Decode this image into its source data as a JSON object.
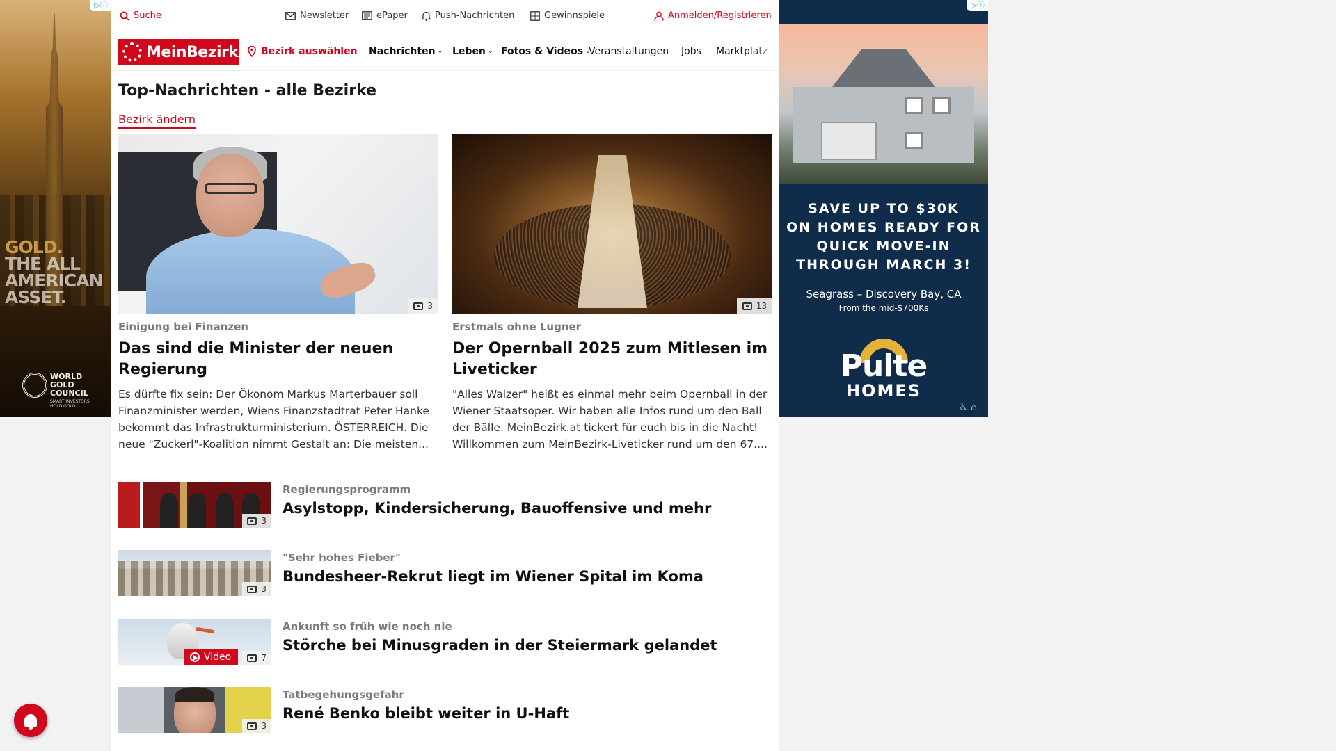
{
  "colors": {
    "brand_red": "#d1081c",
    "kicker_gray": "#7a7a7a"
  },
  "ad_left": {
    "slogan_lines": [
      "GOLD.",
      "THE ALL",
      "AMERICAN",
      "ASSET."
    ],
    "org": "WORLD GOLD COUNCIL",
    "tagline": "SMART INVESTORS HOLD GOLD"
  },
  "ad_right": {
    "headline_lines": [
      "SAVE UP TO $30K",
      "ON HOMES READY FOR",
      "QUICK MOVE-IN",
      "THROUGH MARCH 3!"
    ],
    "location": "Seagrass – Discovery Bay, CA",
    "price": "From the mid-$700Ks",
    "brand_top": "Pulte",
    "brand_bottom": "HOMES"
  },
  "topbar": {
    "search": "Suche",
    "newsletter": "Newsletter",
    "epaper": "ePaper",
    "push": "Push-Nachrichten",
    "gewinnspiele": "Gewinnspiele",
    "login": "Anmelden/Registrieren"
  },
  "nav": {
    "logo": "MeinBezirk",
    "bezirk": "Bezirk auswählen",
    "nachrichten": "Nachrichten",
    "leben": "Leben",
    "fotos": "Fotos & Videos",
    "veranstaltungen": "Veranstaltungen",
    "jobs": "Jobs",
    "marktplatz": "Marktplatz"
  },
  "page": {
    "title": "Top-Nachrichten - alle Bezirke",
    "change_bezirk": "Bezirk ändern"
  },
  "featured": [
    {
      "photo_count": "3",
      "kicker": "Einigung bei Finanzen",
      "headline": "Das sind die Minister der neuen Regierung",
      "teaser": "Es dürfte fix sein: Der Ökonom Markus Marterbauer soll Finanzminister werden, Wiens Finanzstadtrat Peter Hanke bekommt das Infrastrukturministerium. ÖSTERREICH. Die neue \"Zuckerl\"-Koalition nimmt Gestalt an: Die meisten..."
    },
    {
      "photo_count": "13",
      "kicker": "Erstmals ohne Lugner",
      "headline": "Der Opernball 2025 zum Mitlesen im Liveticker",
      "teaser": "\"Alles Walzer\" heißt es einmal mehr beim Opernball in der Wiener Staatsoper. Wir haben alle Infos rund um den Ball der Bälle. MeinBezirk.at tickert für euch bis in die Nacht! Willkommen zum MeinBezirk-Liveticker rund um den 67...."
    }
  ],
  "list": [
    {
      "kicker": "Regierungsprogramm",
      "headline": "Asylstopp, Kindersicherung, Bauoffensive und mehr",
      "photo_count": "3"
    },
    {
      "kicker": "\"Sehr hohes Fieber\"",
      "headline": "Bundesheer-Rekrut liegt im Wiener Spital im Koma",
      "photo_count": "3"
    },
    {
      "kicker": "Ankunft so früh wie noch nie",
      "headline": "Störche bei Minusgraden in der Steiermark gelandet",
      "photo_count": "7",
      "video_label": "Video"
    },
    {
      "kicker": "Tatbegehungsgefahr",
      "headline": "René Benko bleibt weiter in U-Haft",
      "photo_count": "3"
    }
  ]
}
